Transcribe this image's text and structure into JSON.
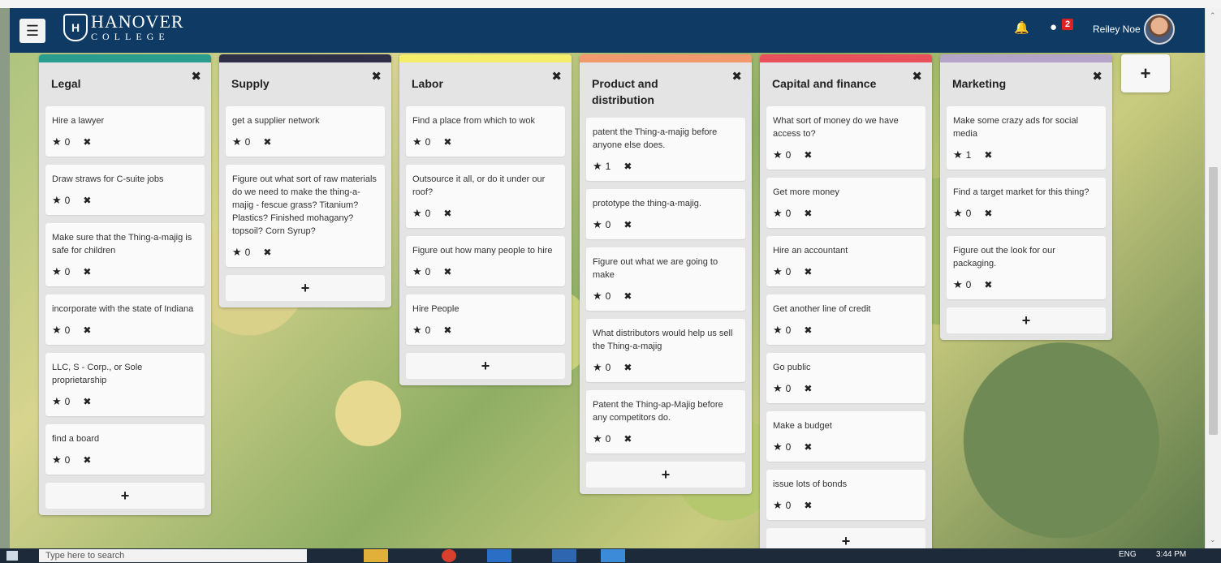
{
  "header": {
    "logo_name": "HANOVER",
    "logo_sub": "COLLEGE",
    "notification_count": "2",
    "user_name": "Reiley Noe"
  },
  "lists": [
    {
      "title": "Legal",
      "color": "#2a9d8f",
      "cards": [
        {
          "text": "Hire a lawyer",
          "votes": "0"
        },
        {
          "text": "Draw straws for C-suite jobs",
          "votes": "0"
        },
        {
          "text": "Make sure that the Thing-a-majig is safe for children",
          "votes": "0"
        },
        {
          "text": "incorporate with the state of Indiana",
          "votes": "0"
        },
        {
          "text": "LLC, S - Corp., or Sole proprietarship",
          "votes": "0"
        },
        {
          "text": "find a board",
          "votes": "0"
        }
      ]
    },
    {
      "title": "Supply",
      "color": "#2f2f4a",
      "cards": [
        {
          "text": "get a supplier network",
          "votes": "0"
        },
        {
          "text": "Figure out what sort of raw materials do we need to make the thing-a-majig - fescue grass? Titanium? Plastics? Finished mohagany? topsoil? Corn Syrup?",
          "votes": "0"
        }
      ]
    },
    {
      "title": "Labor",
      "color": "#f4ee6a",
      "cards": [
        {
          "text": "Find a place from which to wok",
          "votes": "0"
        },
        {
          "text": "Outsource it all, or do it under our roof?",
          "votes": "0"
        },
        {
          "text": "Figure out how many people to hire",
          "votes": "0"
        },
        {
          "text": "Hire People",
          "votes": "0"
        }
      ]
    },
    {
      "title": "Product and distribution",
      "color": "#f29a6e",
      "cards": [
        {
          "text": "patent the Thing-a-majig before anyone else does.",
          "votes": "1"
        },
        {
          "text": "prototype the thing-a-majig.",
          "votes": "0"
        },
        {
          "text": "Figure out what we are going to make",
          "votes": "0"
        },
        {
          "text": "What distributors would help us sell the Thing-a-majig",
          "votes": "0"
        },
        {
          "text": "Patent the Thing-ap-Majig before any competitors do.",
          "votes": "0"
        }
      ]
    },
    {
      "title": "Capital and finance",
      "color": "#e8505b",
      "cards": [
        {
          "text": "What sort of money do we have access to?",
          "votes": "0"
        },
        {
          "text": "Get more money",
          "votes": "0"
        },
        {
          "text": "Hire an accountant",
          "votes": "0"
        },
        {
          "text": "Get another line of credit",
          "votes": "0"
        },
        {
          "text": "Go public",
          "votes": "0"
        },
        {
          "text": "Make a budget",
          "votes": "0"
        },
        {
          "text": "issue lots of bonds",
          "votes": "0"
        }
      ]
    },
    {
      "title": "Marketing",
      "color": "#b4a4c8",
      "cards": [
        {
          "text": "Make some crazy ads for social media",
          "votes": "1"
        },
        {
          "text": "Find a target market for this thing?",
          "votes": "0"
        },
        {
          "text": "Figure out the look for our packaging.",
          "votes": "0"
        }
      ]
    }
  ],
  "icons": {
    "menu": "hamburger-icon",
    "close": "close-icon",
    "star": "star-icon",
    "add": "plus-icon",
    "bell": "bell-icon",
    "chat": "chat-icon"
  },
  "taskbar": {
    "search_placeholder": "Type here to search",
    "lang": "ENG",
    "time": "3:44 PM"
  }
}
